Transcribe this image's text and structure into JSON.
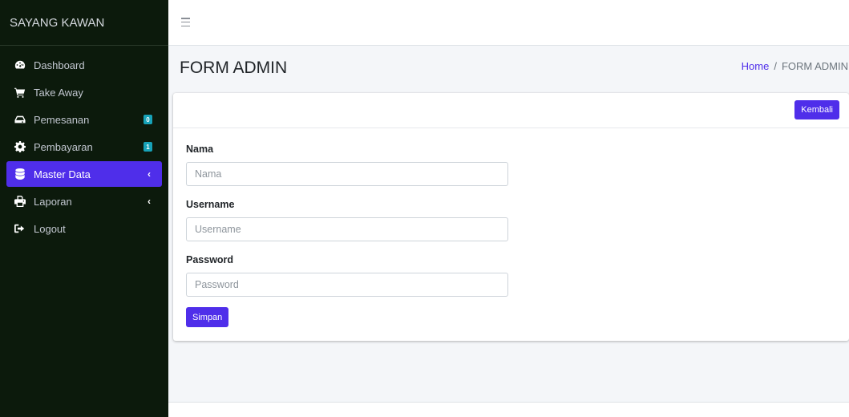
{
  "brand": {
    "title": "SAYANG KAWAN"
  },
  "sidebar": {
    "items": [
      {
        "label": "Dashboard",
        "icon": "tachometer-icon"
      },
      {
        "label": "Take Away",
        "icon": "shopping-cart-icon"
      },
      {
        "label": "Pemesanan",
        "icon": "hdd-icon",
        "badge": "0"
      },
      {
        "label": "Pembayaran",
        "icon": "cog-icon",
        "badge": "1"
      },
      {
        "label": "Master Data",
        "icon": "database-icon",
        "active": true,
        "chevron": "‹"
      },
      {
        "label": "Laporan",
        "icon": "print-icon",
        "chevron": "‹"
      },
      {
        "label": "Logout",
        "icon": "sign-out-icon"
      }
    ]
  },
  "header": {
    "title": "FORM ADMIN",
    "breadcrumb": {
      "home": "Home",
      "separator": "/",
      "current": "FORM ADMIN"
    }
  },
  "card": {
    "back_label": "Kembali",
    "fields": [
      {
        "label": "Nama",
        "placeholder": "Nama",
        "value": ""
      },
      {
        "label": "Username",
        "placeholder": "Username",
        "value": ""
      },
      {
        "label": "Password",
        "placeholder": "Password",
        "value": ""
      }
    ],
    "save_label": "Simpan"
  },
  "colors": {
    "accent": "#4f2eea",
    "sidebar_bg": "#0c1a0c",
    "badge": "#17a2b8"
  }
}
